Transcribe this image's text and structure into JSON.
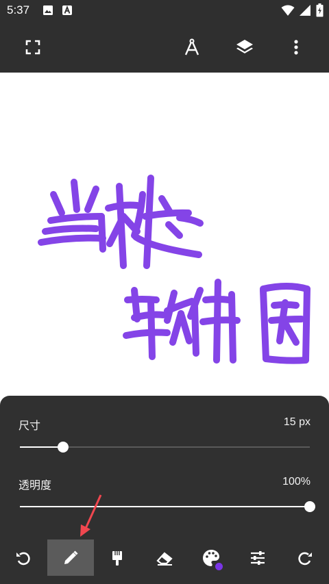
{
  "status_bar": {
    "time": "5:37"
  },
  "toolbar": {
    "icons": [
      "fullscreen-icon",
      "ruler-compass-icon",
      "layers-icon",
      "more-vert-icon"
    ]
  },
  "panel": {
    "size": {
      "label": "尺寸",
      "value_text": "15 px",
      "level": 0.15
    },
    "opacity": {
      "label": "透明度",
      "value_text": "100%",
      "level": 1.0
    }
  },
  "tools": [
    "undo-icon",
    "pencil-icon",
    "brush-icon",
    "eraser-icon",
    "palette-icon",
    "adjust-icon",
    "redo-icon"
  ],
  "active_tool": "pencil",
  "colors": {
    "stroke": "#7a35e6",
    "active_tool_bg": "#5b5b5b",
    "annotation_arrow": "#f0474f"
  }
}
